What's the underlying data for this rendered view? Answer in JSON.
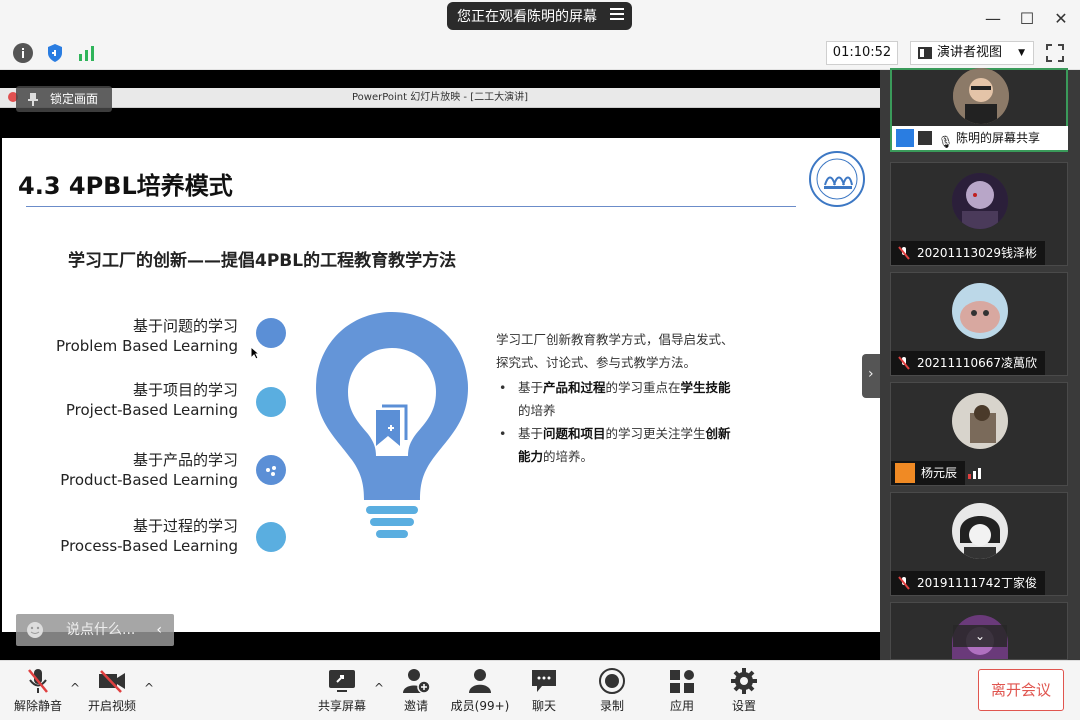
{
  "titlebar": {
    "share_notice": "您正在观看陈明的屏幕",
    "minimize": "—",
    "maximize": "☐",
    "close": "✕"
  },
  "toolbar": {
    "timer": "01:10:52",
    "presenter_view": "演讲者视图"
  },
  "presentation": {
    "window_title": "PowerPoint 幻灯片放映 - [二工大演讲]",
    "lock_label": "锁定画面",
    "slide": {
      "title": "4.3 4PBL培养模式",
      "subtitle": "学习工厂的创新——提倡4PBL的工程教育教学方法",
      "items": [
        {
          "cn": "基于问题的学习",
          "en": "Problem Based Learning"
        },
        {
          "cn": "基于项目的学习",
          "en": "Project-Based Learning"
        },
        {
          "cn": "基于产品的学习",
          "en": "Product-Based Learning"
        },
        {
          "cn": "基于过程的学习",
          "en": "Process-Based Learning"
        }
      ],
      "intro_line1": "学习工厂创新教育教学方式，倡导启发式、",
      "intro_line2": "探究式、讨论式、参与式教学方法。",
      "bullet1_a": "基于",
      "bullet1_b": "产品和过程",
      "bullet1_c": "的学习重点在",
      "bullet1_d": "学生技能",
      "bullet1_e": "的培养",
      "bullet2_a": "基于",
      "bullet2_b": "问题和项目",
      "bullet2_c": "的学习更关注学生",
      "bullet2_d": "创新能力",
      "bullet2_e": "的培养。"
    },
    "chat_placeholder": "说点什么..."
  },
  "participants": [
    {
      "name": "陈明的屏幕共享",
      "muted": false,
      "active": true
    },
    {
      "name": "20201113029钱泽彬",
      "muted": true
    },
    {
      "name": "20211110667凌萬欣",
      "muted": true
    },
    {
      "name": "杨元辰",
      "muted": false
    },
    {
      "name": "20191111742丁家俊",
      "muted": true
    }
  ],
  "bottombar": {
    "unmute": "解除静音",
    "start_video": "开启视频",
    "share_screen": "共享屏幕",
    "invite": "邀请",
    "members": "成员(99+)",
    "chat": "聊天",
    "record": "录制",
    "apps": "应用",
    "settings": "设置",
    "leave": "离开会议"
  },
  "colors": {
    "accent_blue": "#5b8fd6",
    "bulb_blue": "#6495d8",
    "dot_light": "#5aaee0",
    "leave_red": "#e0554f",
    "active_green": "#3a9a5a"
  }
}
